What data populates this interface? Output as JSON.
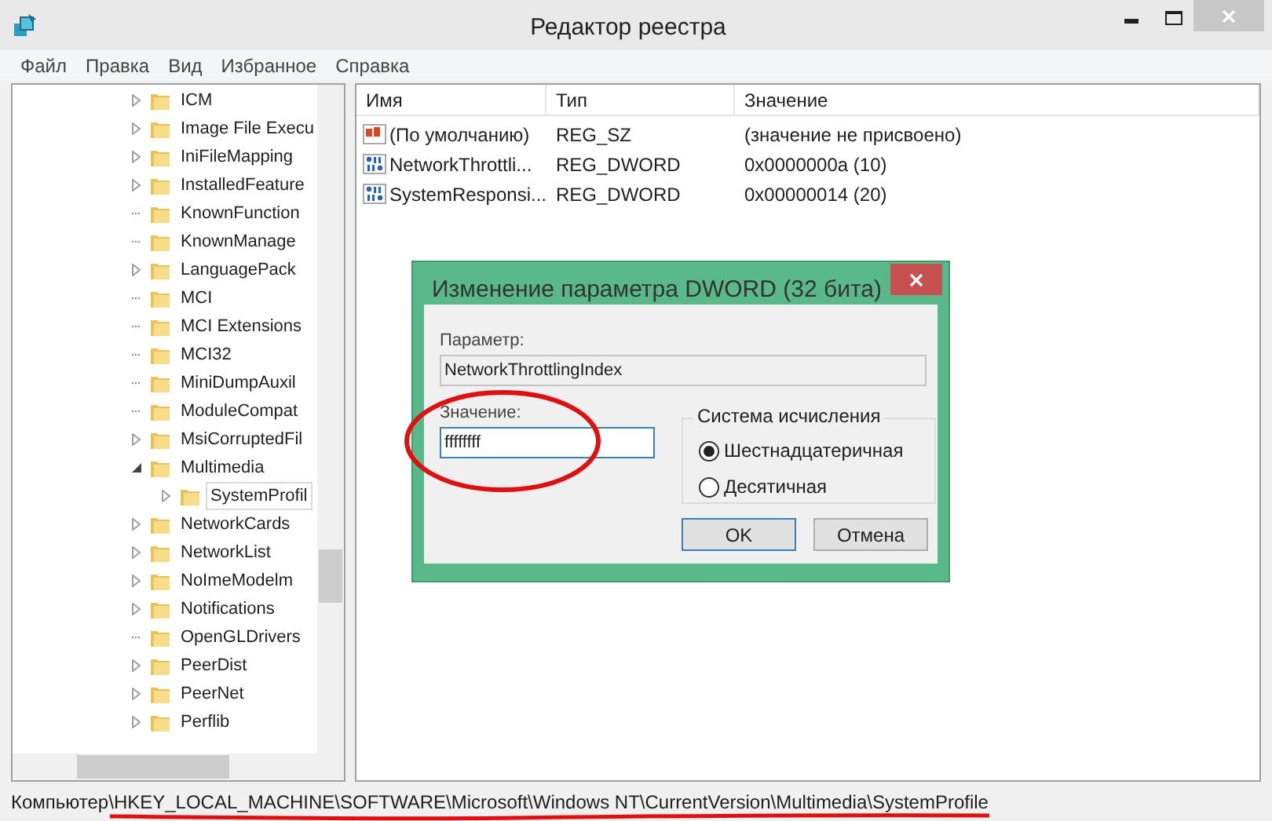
{
  "window": {
    "title": "Редактор реестра"
  },
  "menu": [
    "Файл",
    "Правка",
    "Вид",
    "Избранное",
    "Справка"
  ],
  "tree": [
    {
      "label": "ICM",
      "expandable": true,
      "expanded": false,
      "selected": false
    },
    {
      "label": "Image File Execu",
      "expandable": true,
      "expanded": false,
      "selected": false
    },
    {
      "label": "IniFileMapping",
      "expandable": true,
      "expanded": false,
      "selected": false
    },
    {
      "label": "InstalledFeature",
      "expandable": true,
      "expanded": false,
      "selected": false
    },
    {
      "label": "KnownFunction",
      "expandable": false,
      "selected": false
    },
    {
      "label": "KnownManage",
      "expandable": false,
      "selected": false
    },
    {
      "label": "LanguagePack",
      "expandable": true,
      "expanded": false,
      "selected": false
    },
    {
      "label": "MCI",
      "expandable": false,
      "selected": false
    },
    {
      "label": "MCI Extensions",
      "expandable": false,
      "selected": false
    },
    {
      "label": "MCI32",
      "expandable": false,
      "selected": false
    },
    {
      "label": "MiniDumpAuxil",
      "expandable": false,
      "selected": false
    },
    {
      "label": "ModuleCompat",
      "expandable": false,
      "selected": false
    },
    {
      "label": "MsiCorruptedFil",
      "expandable": true,
      "expanded": false,
      "selected": false
    },
    {
      "label": "Multimedia",
      "expandable": true,
      "expanded": true,
      "selected": false,
      "children": [
        {
          "label": "SystemProfil",
          "expandable": true,
          "expanded": false,
          "selected": true
        }
      ]
    },
    {
      "label": "NetworkCards",
      "expandable": true,
      "expanded": false,
      "selected": false
    },
    {
      "label": "NetworkList",
      "expandable": true,
      "expanded": false,
      "selected": false
    },
    {
      "label": "NoImeModelm",
      "expandable": true,
      "expanded": false,
      "selected": false
    },
    {
      "label": "Notifications",
      "expandable": true,
      "expanded": false,
      "selected": false
    },
    {
      "label": "OpenGLDrivers",
      "expandable": false,
      "selected": false
    },
    {
      "label": "PeerDist",
      "expandable": true,
      "expanded": false,
      "selected": false
    },
    {
      "label": "PeerNet",
      "expandable": true,
      "expanded": false,
      "selected": false
    },
    {
      "label": "Perflib",
      "expandable": true,
      "expanded": false,
      "selected": false
    }
  ],
  "table": {
    "columns": [
      "Имя",
      "Тип",
      "Значение"
    ],
    "rows": [
      {
        "kind": "string",
        "name": "(По умолчанию)",
        "type": "REG_SZ",
        "value": "(значение не присвоено)"
      },
      {
        "kind": "dword",
        "name": "NetworkThrottli...",
        "type": "REG_DWORD",
        "value": "0x0000000a (10)"
      },
      {
        "kind": "dword",
        "name": "SystemResponsi...",
        "type": "REG_DWORD",
        "value": "0x00000014 (20)"
      }
    ]
  },
  "dialog": {
    "title": "Изменение параметра DWORD (32 бита)",
    "name_label": "Параметр:",
    "name_value": "NetworkThrottlingIndex",
    "value_label": "Значение:",
    "value": "ffffffff",
    "base_group": "Система исчисления",
    "bases": [
      {
        "label": "Шестнадцатеричная",
        "selected": true
      },
      {
        "label": "Десятичная",
        "selected": false
      }
    ],
    "buttons": [
      "OK",
      "Отмена"
    ]
  },
  "status_bar": "Компьютер\\HKEY_LOCAL_MACHINE\\SOFTWARE\\Microsoft\\Windows NT\\CurrentVersion\\Multimedia\\SystemProfile"
}
